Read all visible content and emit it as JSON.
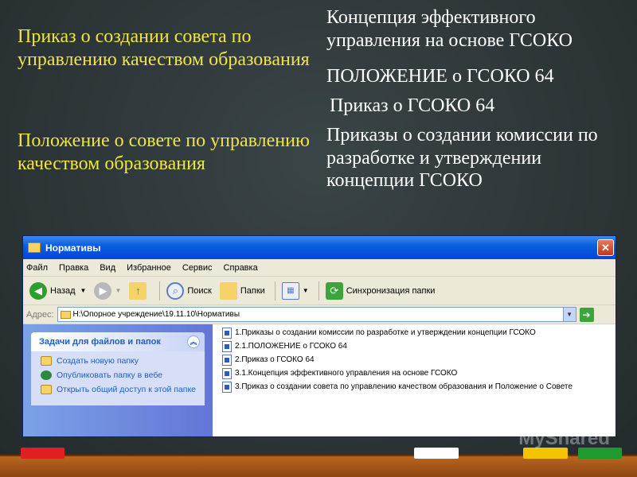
{
  "slide": {
    "left_items": [
      "Приказ о создании совета по управлению качеством образования",
      "Положение о совете по управлению качеством образования"
    ],
    "right_items": [
      "Концепция эффективного управления на основе ГСОКО",
      "ПОЛОЖЕНИЕ о ГСОКО 64",
      "Приказ о ГСОКО 64",
      "Приказы о создании комиссии по разработке и утверждении концепции ГСОКО"
    ]
  },
  "window": {
    "title": "Нормативы",
    "menu": [
      "Файл",
      "Правка",
      "Вид",
      "Избранное",
      "Сервис",
      "Справка"
    ],
    "toolbar": {
      "back": "Назад",
      "search": "Поиск",
      "folders": "Папки",
      "sync": "Синхронизация папки"
    },
    "address": {
      "label": "Адрес:",
      "value": "H:\\Опорное учреждение\\19.11.10\\Нормативы"
    },
    "tasks": {
      "header": "Задачи для файлов и папок",
      "items": [
        "Создать новую папку",
        "Опубликовать папку в вебе",
        "Открыть общий доступ к этой папке"
      ]
    },
    "files": [
      "1.Приказы о создании комиссии по разработке и утверждении концепции ГСОКО",
      "2.1.ПОЛОЖЕНИЕ о ГСОКО 64",
      "2.Приказ о ГСОКО 64",
      "3.1.Концепция эффективного управления на основе ГСОКО",
      "3.Приказ о создании совета по управлению качеством образования и Положение о Совете"
    ]
  },
  "watermark": "MyShared",
  "colors": {
    "left_text": "#f0e442",
    "right_text": "#ffffff",
    "titlebar": "#0a5fe0",
    "chalk_red": "#e02020",
    "chalk_white": "#ffffff",
    "chalk_yellow": "#f5c400",
    "chalk_green": "#1f9a2e"
  }
}
